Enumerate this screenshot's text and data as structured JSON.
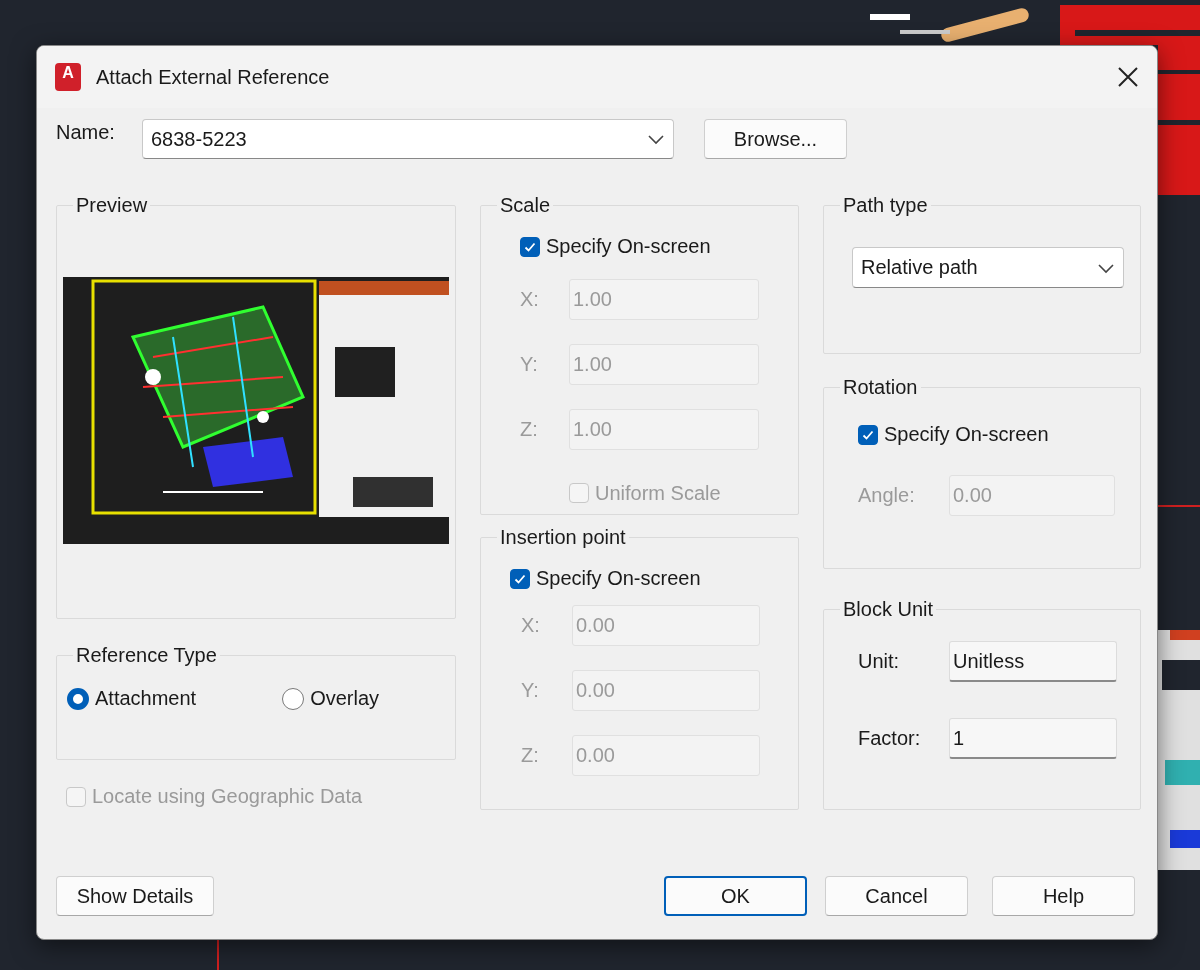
{
  "window": {
    "app_icon_letter": "A",
    "title": "Attach External Reference"
  },
  "name": {
    "label": "Name:",
    "value": "6838-5223"
  },
  "browse_button": "Browse...",
  "preview": {
    "title": "Preview"
  },
  "reference_type": {
    "title": "Reference Type",
    "options": [
      {
        "label": "Attachment",
        "selected": true
      },
      {
        "label": "Overlay",
        "selected": false
      }
    ]
  },
  "locate_geographic": {
    "label": "Locate using Geographic Data",
    "checked": false,
    "disabled": true
  },
  "scale": {
    "title": "Scale",
    "specify_onscreen": {
      "label": "Specify On-screen",
      "checked": true
    },
    "fields": [
      {
        "label": "X:",
        "value": "1.00",
        "disabled": true
      },
      {
        "label": "Y:",
        "value": "1.00",
        "disabled": true
      },
      {
        "label": "Z:",
        "value": "1.00",
        "disabled": true
      }
    ],
    "uniform_scale": {
      "label": "Uniform Scale",
      "checked": false,
      "disabled": true
    }
  },
  "insertion_point": {
    "title": "Insertion point",
    "specify_onscreen": {
      "label": "Specify On-screen",
      "checked": true
    },
    "fields": [
      {
        "label": "X:",
        "value": "0.00",
        "disabled": true
      },
      {
        "label": "Y:",
        "value": "0.00",
        "disabled": true
      },
      {
        "label": "Z:",
        "value": "0.00",
        "disabled": true
      }
    ]
  },
  "path_type": {
    "title": "Path type",
    "value": "Relative path"
  },
  "rotation": {
    "title": "Rotation",
    "specify_onscreen": {
      "label": "Specify On-screen",
      "checked": true
    },
    "angle": {
      "label": "Angle:",
      "value": "0.00",
      "disabled": true
    }
  },
  "block_unit": {
    "title": "Block Unit",
    "fields": [
      {
        "label": "Unit:",
        "value": "Unitless",
        "disabled": false
      },
      {
        "label": "Factor:",
        "value": "1",
        "disabled": false
      }
    ]
  },
  "buttons": [
    {
      "label": "Show Details",
      "default": false
    },
    {
      "label": "OK",
      "default": true
    },
    {
      "label": "Cancel",
      "default": false
    },
    {
      "label": "Help",
      "default": false
    }
  ]
}
